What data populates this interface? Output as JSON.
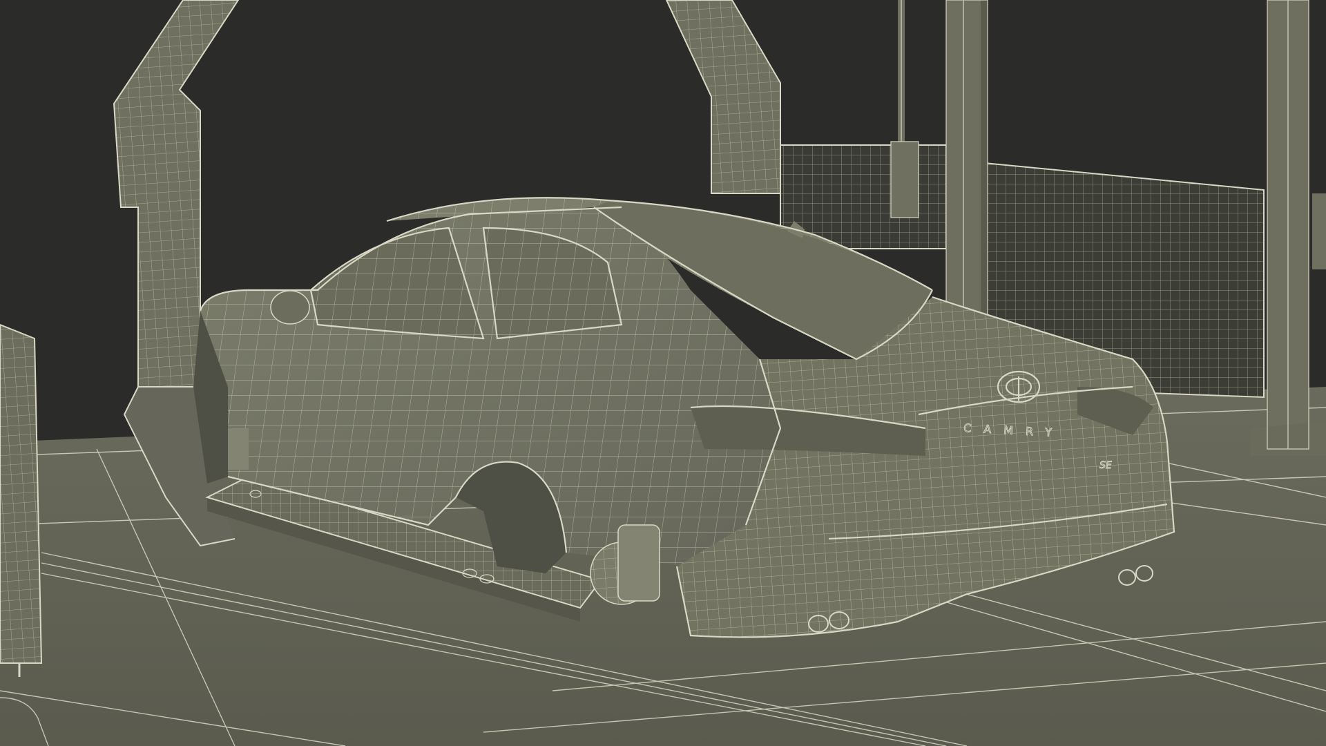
{
  "scene": {
    "kind": "3d-wireframe-render",
    "subject": "sedan-body-on-assembly-line-carrier",
    "colors": {
      "background": "#2b2b29",
      "surface": "#6f705f",
      "surface_dark": "#5a5b4c",
      "surface_light": "#8a8b78",
      "wire": "#d9d8c6",
      "floor": "#5f6052"
    },
    "badges": {
      "trunk_lettering": "CAMRY",
      "trim_badge": "SE"
    }
  }
}
